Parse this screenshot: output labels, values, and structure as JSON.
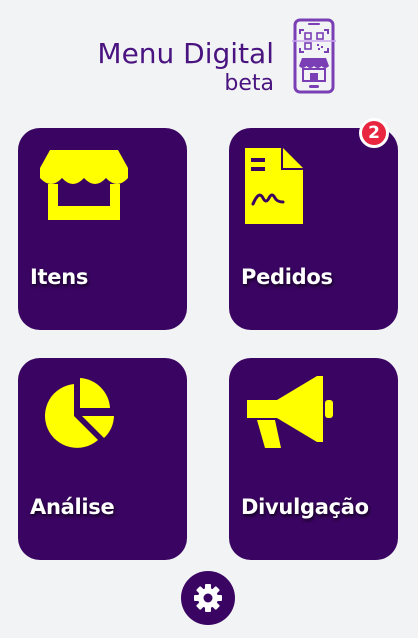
{
  "header": {
    "title": "Menu Digital",
    "subtitle": "beta",
    "logo_icon": "qr-store-phone-icon"
  },
  "tiles": [
    {
      "label": "Itens",
      "icon": "store-icon"
    },
    {
      "label": "Pedidos",
      "icon": "receipt-icon",
      "badge": "2"
    },
    {
      "label": "Análise",
      "icon": "pie-chart-icon"
    },
    {
      "label": "Divulgação",
      "icon": "megaphone-icon"
    }
  ],
  "settings": {
    "icon": "gear-icon"
  },
  "colors": {
    "background": "#f2f3f5",
    "tile": "#3a0562",
    "icon_yellow": "#ffff00",
    "title_purple": "#4a1480",
    "badge_red": "#e8263f"
  }
}
